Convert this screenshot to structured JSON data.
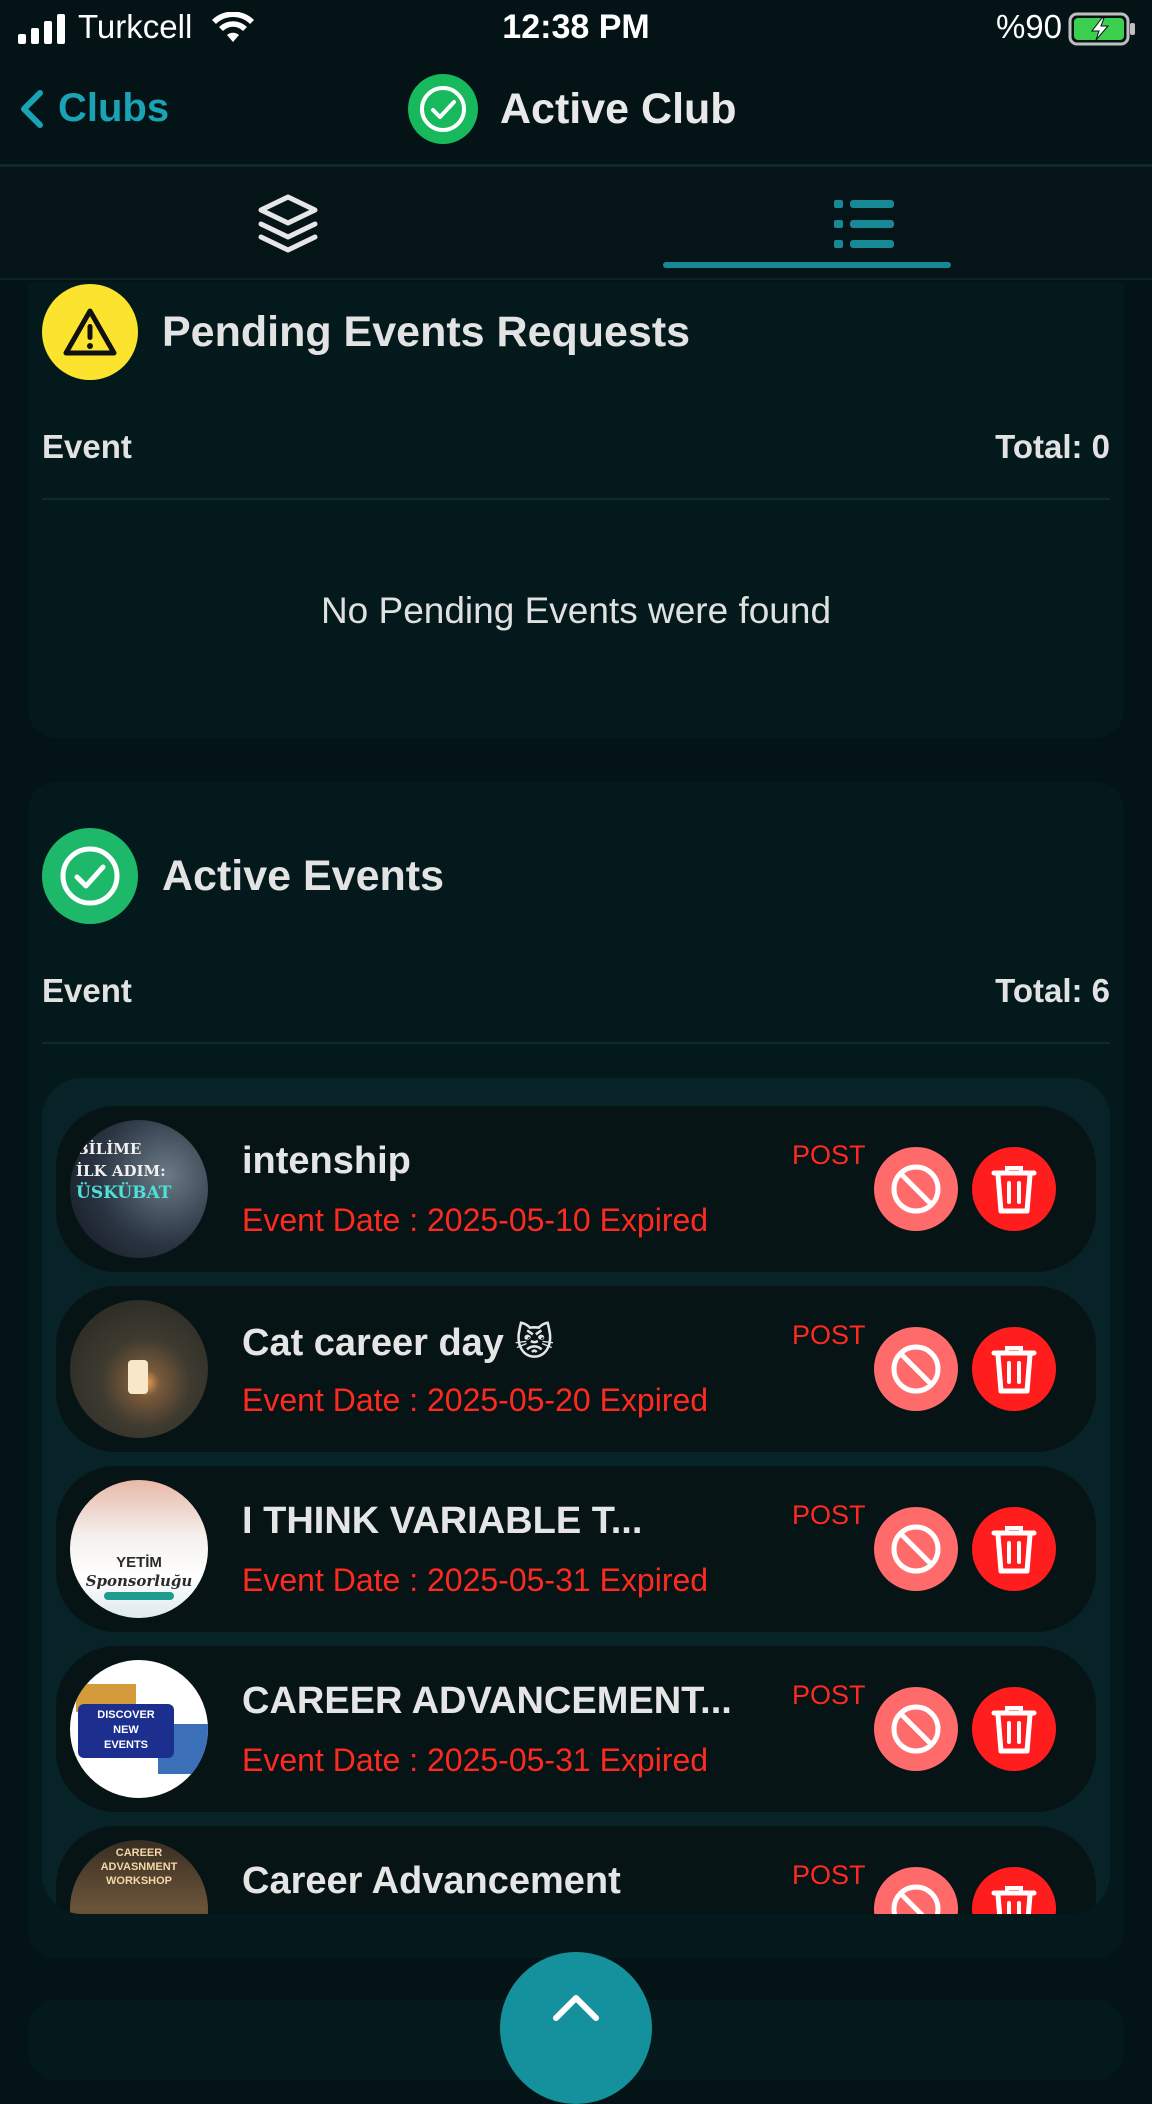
{
  "status_bar": {
    "carrier": "Turkcell",
    "time": "12:38 PM",
    "battery": "%90"
  },
  "header": {
    "back_label": "Clubs",
    "title": "Active Club",
    "accent_color": "#1aa3b5"
  },
  "tabs": [
    {
      "icon": "layers-icon",
      "selected": false
    },
    {
      "icon": "list-icon",
      "selected": true
    }
  ],
  "pending": {
    "title": "Pending Events Requests",
    "column_label": "Event",
    "total_label": "Total: 0",
    "empty_message": "No Pending Events were found"
  },
  "active": {
    "title": "Active Events",
    "column_label": "Event",
    "total_label": "Total: 6",
    "events": [
      {
        "title": "intenship",
        "date": "Event Date : 2025-05-10 Expired",
        "type": "POST"
      },
      {
        "title": "Cat career day 😾",
        "date": "Event Date : 2025-05-20 Expired",
        "type": "POST"
      },
      {
        "title": "I THINK VARIABLE T...",
        "date": "Event Date : 2025-05-31 Expired",
        "type": "POST"
      },
      {
        "title": "CAREER ADVANCEMENT...",
        "date": "Event Date : 2025-05-31 Expired",
        "type": "POST"
      },
      {
        "title": "Career Advancement",
        "date": "",
        "type": "POST"
      }
    ]
  },
  "colors": {
    "expired_red": "#ff2a1f",
    "block_button": "#ff6b6b",
    "delete_button": "#ff1d1d",
    "warning_yellow": "#fbe32e",
    "success_green": "#1db86a"
  },
  "thumbnails": [
    {
      "lines": [
        "BİLİME",
        "İLK ADIM:",
        "ÜSKÜBAT"
      ]
    },
    {
      "lines": []
    },
    {
      "lines": [
        "YETİM",
        "Sponsorluğu"
      ]
    },
    {
      "lines": [
        "DISCOVER",
        "NEW",
        "EVENTS"
      ]
    },
    {
      "lines": [
        "CAREER ADVASNMENT",
        "WORKSHOP"
      ]
    }
  ]
}
